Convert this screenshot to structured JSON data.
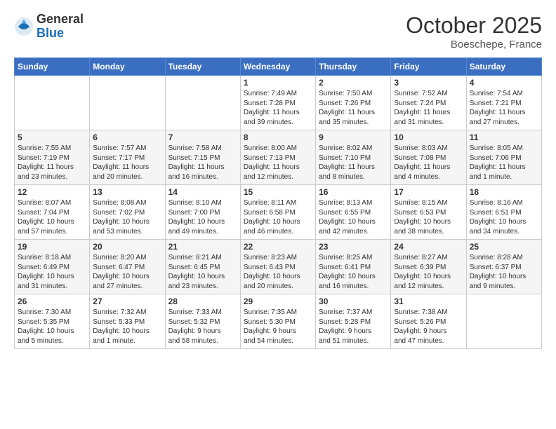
{
  "logo": {
    "general": "General",
    "blue": "Blue"
  },
  "title": "October 2025",
  "location": "Boeschepe, France",
  "days_of_week": [
    "Sunday",
    "Monday",
    "Tuesday",
    "Wednesday",
    "Thursday",
    "Friday",
    "Saturday"
  ],
  "weeks": [
    [
      {
        "day": "",
        "info": ""
      },
      {
        "day": "",
        "info": ""
      },
      {
        "day": "",
        "info": ""
      },
      {
        "day": "1",
        "info": "Sunrise: 7:49 AM\nSunset: 7:28 PM\nDaylight: 11 hours\nand 39 minutes."
      },
      {
        "day": "2",
        "info": "Sunrise: 7:50 AM\nSunset: 7:26 PM\nDaylight: 11 hours\nand 35 minutes."
      },
      {
        "day": "3",
        "info": "Sunrise: 7:52 AM\nSunset: 7:24 PM\nDaylight: 11 hours\nand 31 minutes."
      },
      {
        "day": "4",
        "info": "Sunrise: 7:54 AM\nSunset: 7:21 PM\nDaylight: 11 hours\nand 27 minutes."
      }
    ],
    [
      {
        "day": "5",
        "info": "Sunrise: 7:55 AM\nSunset: 7:19 PM\nDaylight: 11 hours\nand 23 minutes."
      },
      {
        "day": "6",
        "info": "Sunrise: 7:57 AM\nSunset: 7:17 PM\nDaylight: 11 hours\nand 20 minutes."
      },
      {
        "day": "7",
        "info": "Sunrise: 7:58 AM\nSunset: 7:15 PM\nDaylight: 11 hours\nand 16 minutes."
      },
      {
        "day": "8",
        "info": "Sunrise: 8:00 AM\nSunset: 7:13 PM\nDaylight: 11 hours\nand 12 minutes."
      },
      {
        "day": "9",
        "info": "Sunrise: 8:02 AM\nSunset: 7:10 PM\nDaylight: 11 hours\nand 8 minutes."
      },
      {
        "day": "10",
        "info": "Sunrise: 8:03 AM\nSunset: 7:08 PM\nDaylight: 11 hours\nand 4 minutes."
      },
      {
        "day": "11",
        "info": "Sunrise: 8:05 AM\nSunset: 7:06 PM\nDaylight: 11 hours\nand 1 minute."
      }
    ],
    [
      {
        "day": "12",
        "info": "Sunrise: 8:07 AM\nSunset: 7:04 PM\nDaylight: 10 hours\nand 57 minutes."
      },
      {
        "day": "13",
        "info": "Sunrise: 8:08 AM\nSunset: 7:02 PM\nDaylight: 10 hours\nand 53 minutes."
      },
      {
        "day": "14",
        "info": "Sunrise: 8:10 AM\nSunset: 7:00 PM\nDaylight: 10 hours\nand 49 minutes."
      },
      {
        "day": "15",
        "info": "Sunrise: 8:11 AM\nSunset: 6:58 PM\nDaylight: 10 hours\nand 46 minutes."
      },
      {
        "day": "16",
        "info": "Sunrise: 8:13 AM\nSunset: 6:55 PM\nDaylight: 10 hours\nand 42 minutes."
      },
      {
        "day": "17",
        "info": "Sunrise: 8:15 AM\nSunset: 6:53 PM\nDaylight: 10 hours\nand 38 minutes."
      },
      {
        "day": "18",
        "info": "Sunrise: 8:16 AM\nSunset: 6:51 PM\nDaylight: 10 hours\nand 34 minutes."
      }
    ],
    [
      {
        "day": "19",
        "info": "Sunrise: 8:18 AM\nSunset: 6:49 PM\nDaylight: 10 hours\nand 31 minutes."
      },
      {
        "day": "20",
        "info": "Sunrise: 8:20 AM\nSunset: 6:47 PM\nDaylight: 10 hours\nand 27 minutes."
      },
      {
        "day": "21",
        "info": "Sunrise: 8:21 AM\nSunset: 6:45 PM\nDaylight: 10 hours\nand 23 minutes."
      },
      {
        "day": "22",
        "info": "Sunrise: 8:23 AM\nSunset: 6:43 PM\nDaylight: 10 hours\nand 20 minutes."
      },
      {
        "day": "23",
        "info": "Sunrise: 8:25 AM\nSunset: 6:41 PM\nDaylight: 10 hours\nand 16 minutes."
      },
      {
        "day": "24",
        "info": "Sunrise: 8:27 AM\nSunset: 6:39 PM\nDaylight: 10 hours\nand 12 minutes."
      },
      {
        "day": "25",
        "info": "Sunrise: 8:28 AM\nSunset: 6:37 PM\nDaylight: 10 hours\nand 9 minutes."
      }
    ],
    [
      {
        "day": "26",
        "info": "Sunrise: 7:30 AM\nSunset: 5:35 PM\nDaylight: 10 hours\nand 5 minutes."
      },
      {
        "day": "27",
        "info": "Sunrise: 7:32 AM\nSunset: 5:33 PM\nDaylight: 10 hours\nand 1 minute."
      },
      {
        "day": "28",
        "info": "Sunrise: 7:33 AM\nSunset: 5:32 PM\nDaylight: 9 hours\nand 58 minutes."
      },
      {
        "day": "29",
        "info": "Sunrise: 7:35 AM\nSunset: 5:30 PM\nDaylight: 9 hours\nand 54 minutes."
      },
      {
        "day": "30",
        "info": "Sunrise: 7:37 AM\nSunset: 5:28 PM\nDaylight: 9 hours\nand 51 minutes."
      },
      {
        "day": "31",
        "info": "Sunrise: 7:38 AM\nSunset: 5:26 PM\nDaylight: 9 hours\nand 47 minutes."
      },
      {
        "day": "",
        "info": ""
      }
    ]
  ]
}
